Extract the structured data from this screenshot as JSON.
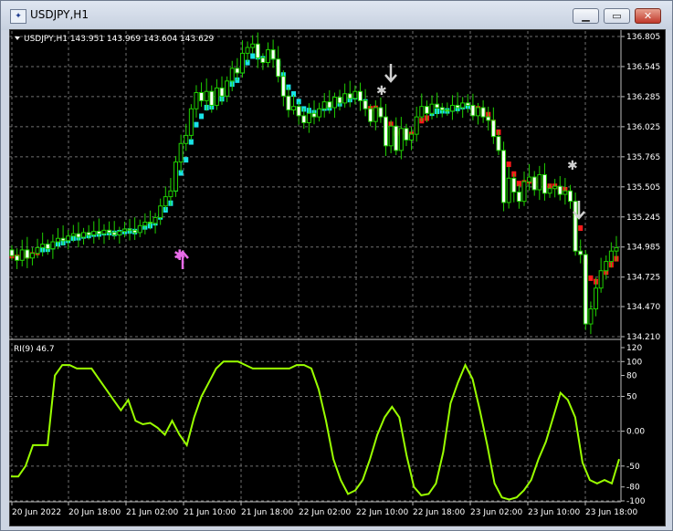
{
  "window": {
    "title": "USDJPY,H1",
    "icon_name": "chart-window-icon",
    "buttons": [
      {
        "name": "minimize-button",
        "glyph": "▁"
      },
      {
        "name": "maximize-button",
        "glyph": "▭"
      },
      {
        "name": "close-button",
        "glyph": "✕"
      }
    ]
  },
  "main_panel": {
    "header": "USDJPY,H1  143.951 143.969 143.604 143.629",
    "header_icon": "triangle-down-icon",
    "price_ticks": [
      "136.805",
      "136.545",
      "136.285",
      "136.025",
      "135.765",
      "135.505",
      "135.245",
      "134.985",
      "134.725",
      "134.470",
      "134.210"
    ],
    "colors": {
      "bull_candle": "#1fd000",
      "bear_candle": "#ffffff",
      "trend_up": "#19e3e8",
      "trend_down": "#ff1a1a",
      "buy_signal": "#e86be8",
      "sell_signal": "#d0d0d0",
      "grid": "#6f6f6f"
    }
  },
  "indicator_panel": {
    "header": "RI(9) 46.7",
    "ticks": [
      "120",
      "100",
      "80",
      "50",
      "0.00",
      "-50",
      "-80",
      "-100"
    ],
    "line_color": "#9aff00"
  },
  "time_axis": [
    "20 Jun 2022",
    "20 Jun 18:00",
    "21 Jun 02:00",
    "21 Jun 10:00",
    "21 Jun 18:00",
    "22 Jun 02:00",
    "22 Jun 10:00",
    "22 Jun 18:00",
    "23 Jun 02:00",
    "23 Jun 10:00",
    "23 Jun 18:00"
  ],
  "chart_data": [
    {
      "type": "candlestick",
      "symbol": "USDJPY",
      "timeframe": "H1",
      "y_range": [
        134.21,
        136.805
      ],
      "x_range": [
        "20 Jun 2022 00:00",
        "23 Jun 2022 19:00"
      ],
      "close": [
        134.91,
        134.87,
        134.96,
        134.89,
        134.93,
        134.98,
        135.01,
        134.97,
        135.03,
        135.06,
        135.04,
        135.08,
        135.1,
        135.07,
        135.11,
        135.09,
        135.12,
        135.1,
        135.13,
        135.11,
        135.09,
        135.12,
        135.14,
        135.13,
        135.11,
        135.17,
        135.2,
        135.19,
        135.24,
        135.34,
        135.42,
        135.47,
        135.72,
        135.88,
        135.95,
        136.18,
        136.32,
        136.25,
        136.33,
        136.21,
        136.36,
        136.29,
        136.42,
        136.53,
        136.49,
        136.66,
        136.71,
        136.74,
        136.62,
        136.58,
        136.69,
        136.61,
        136.46,
        136.29,
        136.17,
        136.2,
        136.12,
        136.06,
        136.14,
        136.11,
        136.18,
        136.24,
        136.19,
        136.28,
        136.23,
        136.31,
        136.27,
        136.33,
        136.25,
        136.18,
        136.07,
        136.19,
        136.11,
        135.86,
        136.03,
        135.82,
        136.01,
        135.91,
        135.96,
        136.11,
        136.2,
        136.14,
        136.22,
        136.19,
        136.17,
        136.16,
        136.21,
        136.19,
        136.23,
        136.21,
        136.12,
        136.19,
        136.11,
        136.08,
        135.94,
        135.82,
        135.37,
        135.58,
        135.46,
        135.38,
        135.55,
        135.59,
        135.48,
        135.61,
        135.45,
        135.49,
        135.51,
        135.44,
        135.47,
        135.38,
        134.95,
        134.92,
        134.32,
        134.45,
        134.63,
        134.78,
        134.86,
        134.95,
        134.98
      ],
      "signals": [
        {
          "type": "buy",
          "time": "21 Jun 10:00"
        },
        {
          "type": "sell",
          "time": "22 Jun 09:00"
        },
        {
          "type": "sell",
          "time": "23 Jun 11:00"
        }
      ]
    },
    {
      "type": "line",
      "name": "RI(9)",
      "ylim": [
        -100,
        120
      ],
      "values": [
        -65,
        -65,
        -50,
        -20,
        -20,
        -20,
        80,
        95,
        95,
        90,
        90,
        90,
        75,
        60,
        45,
        30,
        45,
        15,
        10,
        12,
        5,
        -5,
        15,
        -5,
        -20,
        20,
        50,
        70,
        90,
        100,
        100,
        100,
        95,
        90,
        90,
        90,
        90,
        90,
        90,
        95,
        95,
        90,
        60,
        15,
        -40,
        -70,
        -90,
        -85,
        -70,
        -40,
        -5,
        20,
        35,
        20,
        -35,
        -80,
        -92,
        -90,
        -75,
        -30,
        40,
        70,
        95,
        75,
        30,
        -20,
        -75,
        -95,
        -98,
        -95,
        -85,
        -70,
        -40,
        -15,
        20,
        55,
        45,
        20,
        -45,
        -70,
        -75,
        -70,
        -75,
        -40
      ]
    }
  ]
}
